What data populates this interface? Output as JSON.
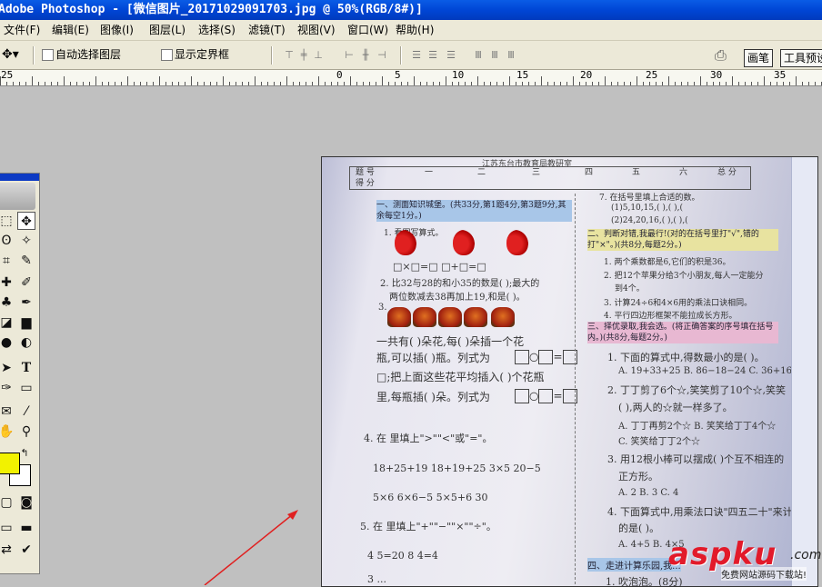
{
  "window": {
    "title": "Adobe Photoshop - [微信图片_20171029091703.jpg @ 50%(RGB/8#)]"
  },
  "menu": {
    "items": [
      "文件(F)",
      "编辑(E)",
      "图像(I)",
      "图层(L)",
      "选择(S)",
      "滤镜(T)",
      "视图(V)",
      "窗口(W)",
      "帮助(H)"
    ]
  },
  "options_bar": {
    "auto_select_layer": "自动选择图层",
    "show_bounding_box": "显示定界框",
    "panel_tabs": [
      "画笔",
      "工具预设"
    ]
  },
  "ruler": {
    "labels": [
      "25",
      "0",
      "5",
      "10",
      "15",
      "20",
      "25",
      "30",
      "35"
    ]
  },
  "document": {
    "header_stamp": "江苏东台市教育局教研室",
    "score_table": {
      "row1": [
        "题 号",
        "一",
        "二",
        "三",
        "四",
        "五",
        "六",
        "总 分"
      ],
      "row2": [
        "得 分"
      ]
    },
    "left": {
      "section1": "一、测面知识城堡。(共33分,第1题4分,第3题9分,其余每空1分。)",
      "q1": "1. 看图写算式。",
      "q1_boxes": "□×□=□   □+□=□",
      "q2": "2. 比32与28的和小35的数是(      );最大的",
      "q2b": "两位数减去38再加上19,和是(      )。",
      "q3": "3.",
      "q3a": "一共有(      )朵花,每(      )朵插一个花",
      "q3b": "瓶,可以插(      )瓶。列式为",
      "q3c": "□;把上面这些花平均插入(      )个花瓶",
      "q3d": "里,每瓶插(      )朵。列式为",
      "q4": "4. 在     里填上\">\"\"<\"或\"=\"。",
      "q4a": "18+25+19      18+19+25     3×5      20−5",
      "q4b": "5×6      6×6−5              5×5+6      30",
      "q5": "5. 在      里填上\"+\"\"−\"\"×\"\"÷\"。",
      "q5a": "4      5=20                    8      4=4",
      "q5b": "3      ..."
    },
    "right": {
      "q7": "7. 在括号里填上合适的数。",
      "q7a": "(1)5,10,15,(      ),(      ),(",
      "q7b": "(2)24,20,16,(      ),(      ),(",
      "section2": "二、判断对错,我最行!(对的在括号里打\"√\",错的打\"×\"。)(共8分,每题2分。)",
      "j1": "1. 两个乘数都是6,它们的积是36。",
      "j2": "2. 把12个苹果分给3个小朋友,每人一定能分",
      "j2b": "到4个。",
      "j3": "3. 计算24÷6和4×6用的乘法口诀相同。",
      "j4": "4. 平行四边形框架不能拉成长方形。",
      "section3": "三、择优录取,我会选。(将正确答案的序号填在括号内。)(共8分,每题2分。)",
      "c1": "1. 下面的算式中,得数最小的是(      )。",
      "c1a": "A. 19+33+25    B. 86−18−24    C. 36+16",
      "c2": "2. 丁丁剪了6个☆,笑笑剪了10个☆,笑笑",
      "c2b": "(      ),两人的☆就一样多了。",
      "c2c": "A. 丁丁再剪2个☆     B. 笑笑给丁丁4个☆",
      "c2d": "C. 笑笑给丁丁2个☆",
      "c3": "3. 用12根小棒可以摆成(      )个互不相连的",
      "c3b": "正方形。",
      "c3c": "A. 2              B. 3              C. 4",
      "c4": "4. 下面算式中,用乘法口诀\"四五二十\"来计算",
      "c4b": "的是(      )。",
      "c4c": "A. 4+5            B. 4×5",
      "section4": "四、走进计算乐园,我...",
      "s4a": "1. 吹泡泡。(8分)"
    }
  },
  "watermark": {
    "brand": "aspku",
    "dotcom": ".com",
    "sub": "免费网站源码下载站!"
  },
  "colors": {
    "title_bar": "#0046d5",
    "menu_bg": "#ece9d8",
    "canvas_bg": "#c0c0c0",
    "foreground_swatch": "#f2f200",
    "arrow": "#e02020",
    "watermark_red": "#e21a2a"
  },
  "icons": [
    "move-tool-icon",
    "marquee-tool-icon",
    "lasso-tool-icon",
    "magic-wand-icon",
    "crop-tool-icon",
    "slice-tool-icon",
    "healing-brush-icon",
    "brush-tool-icon",
    "clone-stamp-icon",
    "history-brush-icon",
    "eraser-icon",
    "gradient-icon",
    "blur-icon",
    "dodge-icon",
    "path-select-icon",
    "type-tool-icon",
    "pen-tool-icon",
    "shape-tool-icon",
    "notes-icon",
    "eyedropper-icon",
    "hand-tool-icon",
    "zoom-tool-icon"
  ]
}
